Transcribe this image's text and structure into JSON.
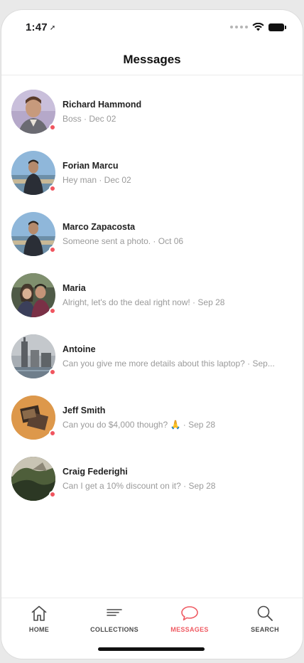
{
  "status_bar": {
    "time": "1:47",
    "location_glyph": "➚"
  },
  "nav": {
    "title": "Messages"
  },
  "messages": [
    {
      "name": "Richard Hammond",
      "preview": "Boss · Dec 02",
      "online": true
    },
    {
      "name": "Forian Marcu",
      "preview": "Hey man · Dec 02",
      "online": true
    },
    {
      "name": "Marco Zapacosta",
      "preview": "Someone sent a photo. · Oct 06",
      "online": true
    },
    {
      "name": "Maria",
      "preview": "Alright, let's do the deal right now! · Sep 28",
      "online": true
    },
    {
      "name": "Antoine",
      "preview": "Can you give me more details about this laptop? · Sep...",
      "online": true
    },
    {
      "name": "Jeff Smith",
      "preview": "Can you do $4,000 though? 🙏 · Sep 28",
      "online": true
    },
    {
      "name": "Craig Federighi",
      "preview": "Can I get a 10% discount on it? · Sep 28",
      "online": true
    }
  ],
  "tabs": [
    {
      "label": "HOME",
      "icon": "home-icon",
      "active": false
    },
    {
      "label": "COLLECTIONS",
      "icon": "collections-icon",
      "active": false
    },
    {
      "label": "MESSAGES",
      "icon": "chat-bubble-icon",
      "active": true
    },
    {
      "label": "SEARCH",
      "icon": "search-icon",
      "active": false
    }
  ],
  "colors": {
    "accent": "#ef5a62",
    "online_dot": "#f0555f",
    "text_secondary": "#9a9a9a"
  }
}
